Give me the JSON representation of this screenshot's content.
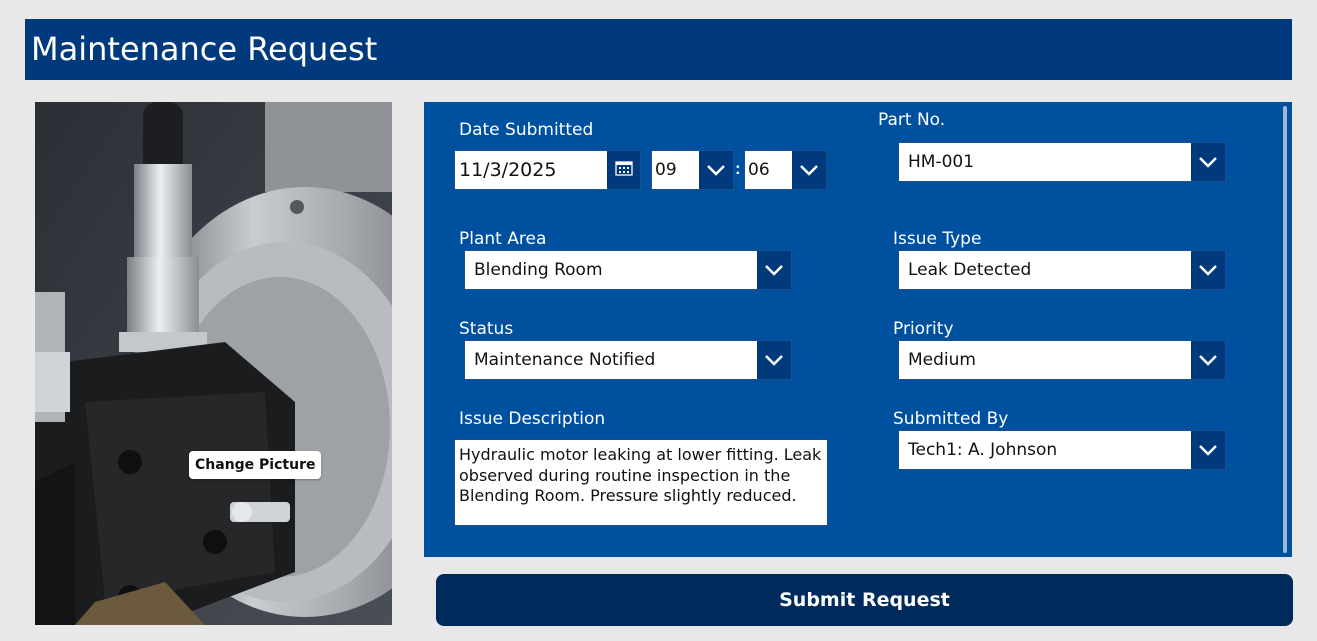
{
  "header": {
    "title": "Maintenance Request"
  },
  "photo": {
    "change_picture_label": "Change Picture"
  },
  "form": {
    "date_submitted": {
      "label": "Date Submitted",
      "value": "11/3/2025",
      "hour": "09",
      "minute": "06",
      "separator": ":"
    },
    "part_no": {
      "label": "Part No.",
      "value": "HM-001"
    },
    "plant_area": {
      "label": "Plant Area",
      "value": "Blending Room"
    },
    "issue_type": {
      "label": "Issue Type",
      "value": "Leak Detected"
    },
    "status": {
      "label": "Status",
      "value": "Maintenance Notified"
    },
    "priority": {
      "label": "Priority",
      "value": "Medium"
    },
    "issue_description": {
      "label": "Issue Description",
      "value": "Hydraulic motor leaking at lower fitting. Leak observed during routine inspection in the Blending Room. Pressure slightly reduced."
    },
    "submitted_by": {
      "label": "Submitted By",
      "value": "Tech1: A. Johnson"
    }
  },
  "actions": {
    "submit_label": "Submit Request"
  },
  "icons": {
    "calendar": "calendar-icon",
    "dropdown": "chevron-down-icon"
  },
  "colors": {
    "header": "#003a7d",
    "form_panel": "#0050a0",
    "submit": "#002a5c",
    "background": "#e8e8e8"
  }
}
